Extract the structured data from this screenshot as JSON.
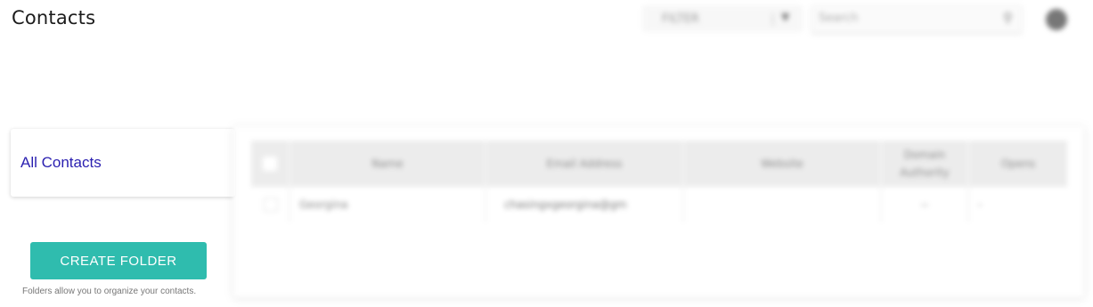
{
  "header": {
    "title": "Contacts",
    "filter_label": "FILTER",
    "search_placeholder": "Search"
  },
  "sidebar": {
    "folders": [
      {
        "label": "All Contacts"
      }
    ],
    "create_folder_label": "CREATE FOLDER",
    "hint": "Folders allow you to organize your contacts."
  },
  "table": {
    "columns": [
      "Name",
      "Email Address",
      "Website",
      "Domain Authority",
      "Opens"
    ],
    "rows": [
      {
        "name": "Georgina",
        "email": "chasingxgeorgina@gm",
        "website": "",
        "authority": "--",
        "opens": "-"
      }
    ]
  },
  "colors": {
    "accent": "#2fbcae",
    "folder_link": "#2a1fb0"
  }
}
